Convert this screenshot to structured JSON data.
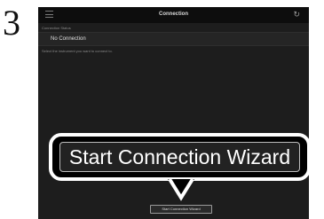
{
  "step_number": "3",
  "header": {
    "title": "Connection",
    "menu_icon": "hamburger-menu-icon",
    "refresh_icon": "refresh-icon"
  },
  "connection_status": {
    "label": "Connection Status",
    "value": "No Connection"
  },
  "instruction": "Select the instrument you want to connect to.",
  "wizard_button_label": "Start Connection Wizard",
  "callout_label": "Start Connection Wizard",
  "colors": {
    "screen_background": "#1d1d1d",
    "topbar_background": "#0d0d0d",
    "callout_border": "#ffffff",
    "callout_background": "#000000"
  }
}
